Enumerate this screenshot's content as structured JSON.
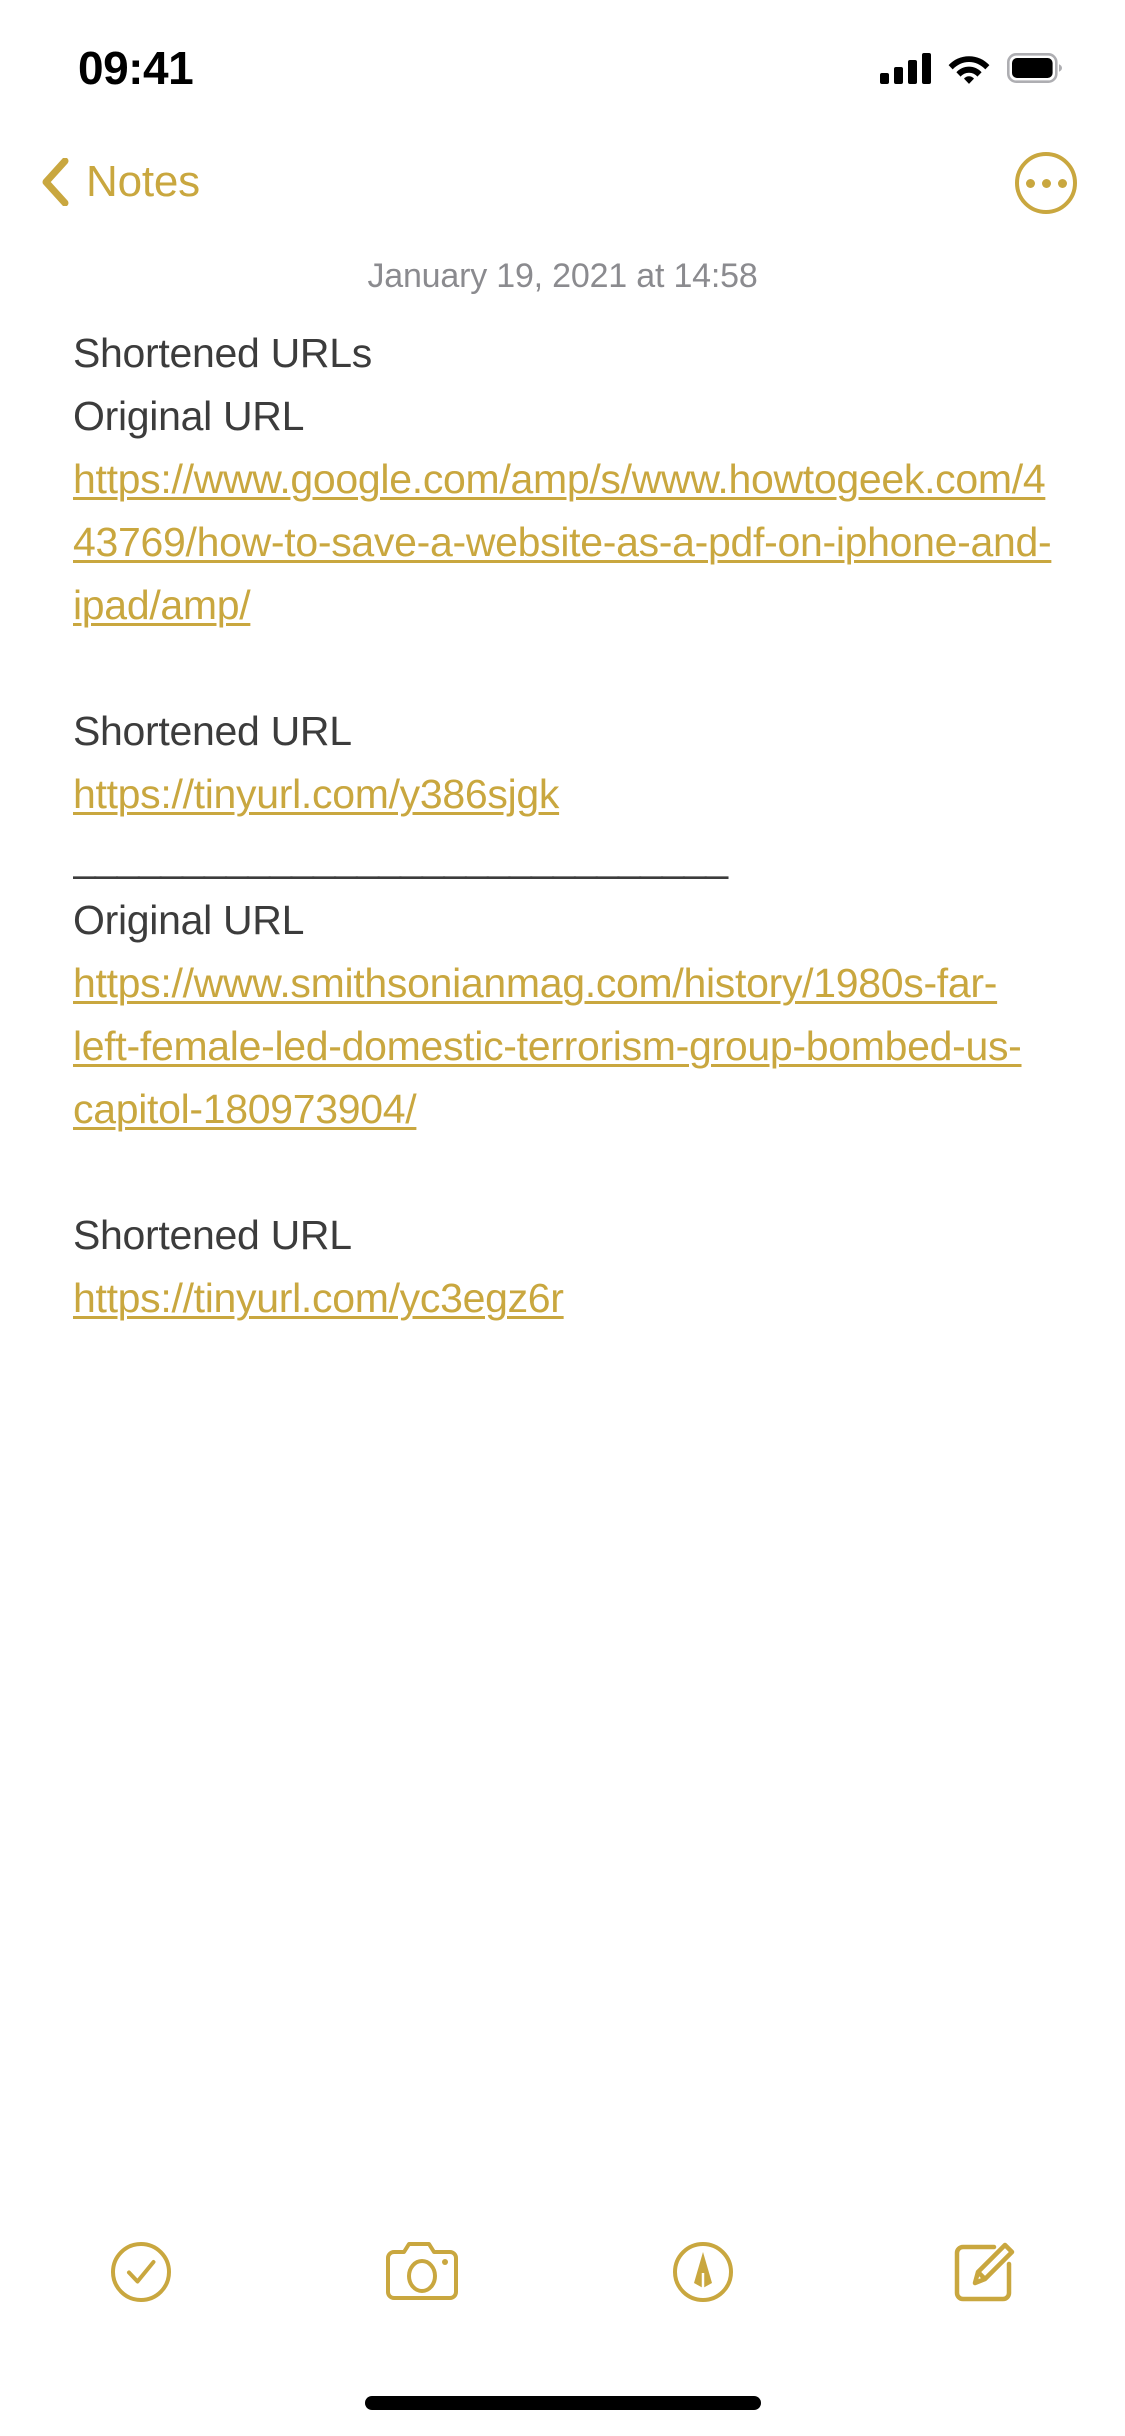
{
  "theme": {
    "accent": "#C9A73F",
    "body_text": "#3C3C3C",
    "muted_text": "#8B8B8F",
    "background": "#FFFFFF"
  },
  "status_bar": {
    "time": "09:41",
    "cellular_icon": "signal-bars-icon",
    "cellular_bars": 4,
    "wifi_icon": "wifi-icon",
    "battery_icon": "battery-icon",
    "battery_full": true
  },
  "nav_bar": {
    "back_icon": "chevron-left-icon",
    "back_label": "Notes",
    "more_icon": "ellipsis-circle-icon"
  },
  "note": {
    "date": "January 19, 2021 at 14:58",
    "lines": [
      {
        "text": "Shortened URLs",
        "type": "text"
      },
      {
        "text": "Original URL",
        "type": "text"
      },
      {
        "text": "https://www.google.com/amp/s/www.howtogeek.com/443769/how-to-save-a-website-as-a-pdf-on-iphone-and-ipad/amp/",
        "type": "link"
      },
      {
        "text": " ",
        "type": "blank"
      },
      {
        "text": "Shortened URL",
        "type": "text"
      },
      {
        "text": "https://tinyurl.com/y386sjgk",
        "type": "link"
      },
      {
        "text": "______________________________",
        "type": "rule"
      },
      {
        "text": "Original URL",
        "type": "text"
      },
      {
        "text": "https://www.smithsonianmag.com/history/1980s-far-left-female-led-domestic-terrorism-group-bombed-us-capitol-180973904/",
        "type": "link"
      },
      {
        "text": " ",
        "type": "blank"
      },
      {
        "text": "Shortened URL",
        "type": "text"
      },
      {
        "text": "https://tinyurl.com/yc3egz6r",
        "type": "link"
      }
    ]
  },
  "toolbar": {
    "items": [
      {
        "icon": "checklist-circle-icon",
        "name": "checklist-button"
      },
      {
        "icon": "camera-icon",
        "name": "camera-button"
      },
      {
        "icon": "markup-pen-circle-icon",
        "name": "markup-button"
      },
      {
        "icon": "compose-square-pencil-icon",
        "name": "compose-button"
      }
    ]
  },
  "home_indicator": "home-indicator"
}
